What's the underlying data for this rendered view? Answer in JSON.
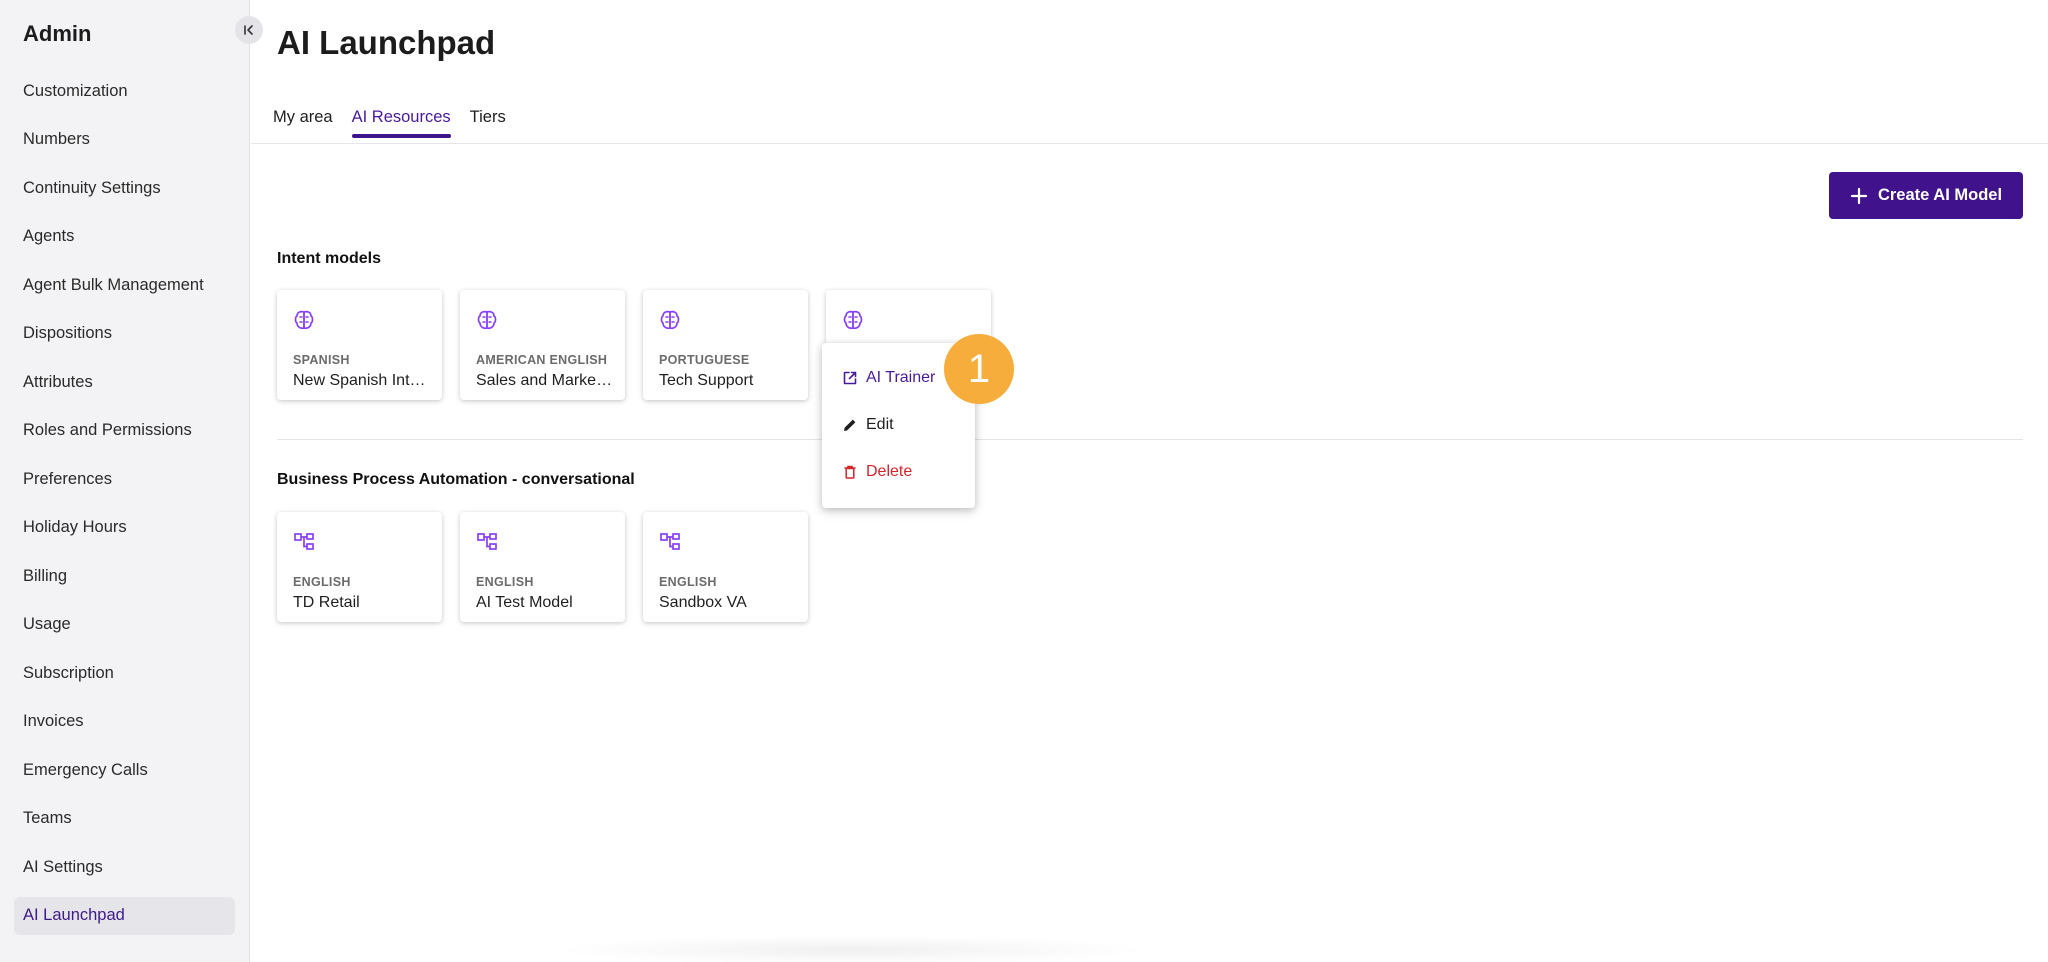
{
  "sidebar": {
    "title": "Admin",
    "items": [
      {
        "label": "Customization"
      },
      {
        "label": "Numbers"
      },
      {
        "label": "Continuity Settings"
      },
      {
        "label": "Agents"
      },
      {
        "label": "Agent Bulk Management"
      },
      {
        "label": "Dispositions"
      },
      {
        "label": "Attributes"
      },
      {
        "label": "Roles and Permissions"
      },
      {
        "label": "Preferences"
      },
      {
        "label": "Holiday Hours"
      },
      {
        "label": "Billing"
      },
      {
        "label": "Usage"
      },
      {
        "label": "Subscription"
      },
      {
        "label": "Invoices"
      },
      {
        "label": "Emergency Calls"
      },
      {
        "label": "Teams"
      },
      {
        "label": "AI Settings"
      },
      {
        "label": "AI Launchpad",
        "active": true
      }
    ]
  },
  "page": {
    "title": "AI Launchpad",
    "tabs": [
      {
        "label": "My area"
      },
      {
        "label": "AI Resources",
        "active": true
      },
      {
        "label": "Tiers"
      }
    ],
    "create_button": "Create AI Model"
  },
  "sections": {
    "intent": {
      "title": "Intent models",
      "icon": "brain-icon",
      "cards": [
        {
          "language": "SPANISH",
          "name": "New Spanish Intent Model"
        },
        {
          "language": "AMERICAN ENGLISH",
          "name": "Sales and Marketing"
        },
        {
          "language": "PORTUGUESE",
          "name": "Tech Support"
        }
      ]
    },
    "bpa": {
      "title": "Business Process Automation - conversational",
      "icon": "flow-icon",
      "cards": [
        {
          "language": "ENGLISH",
          "name": "TD Retail"
        },
        {
          "language": "ENGLISH",
          "name": "AI Test Model"
        },
        {
          "language": "ENGLISH",
          "name": "Sandbox VA"
        }
      ]
    }
  },
  "context_menu": {
    "trainer": "AI Trainer",
    "edit": "Edit",
    "delete": "Delete"
  },
  "step_badge": "1",
  "colors": {
    "accent": "#40128b",
    "icon_purple": "#8a3ffc",
    "delete_red": "#d4242b",
    "badge_orange": "#f6ad3c"
  }
}
